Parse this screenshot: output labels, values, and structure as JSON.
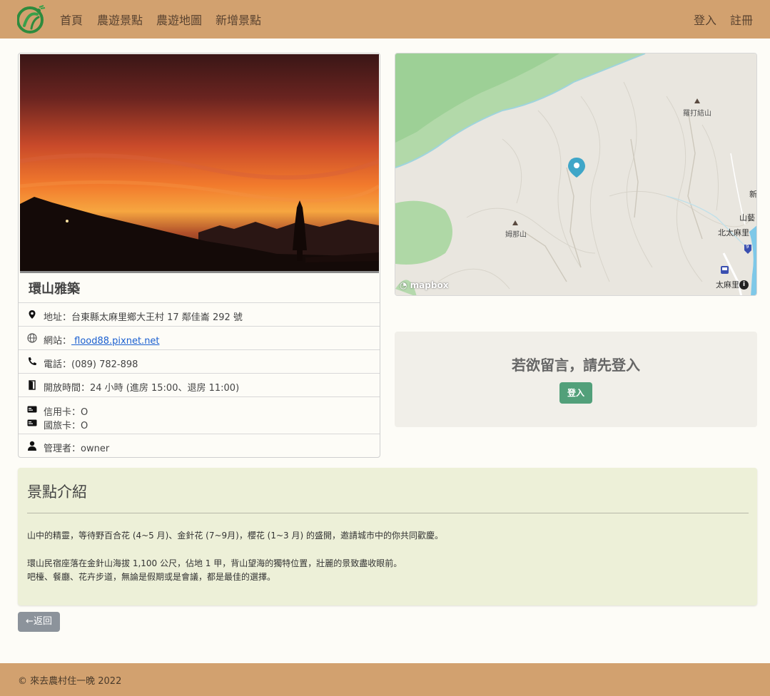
{
  "nav": {
    "home": "首頁",
    "spots": "農遊景點",
    "map": "農遊地圖",
    "add_spot": "新增景點",
    "login": "登入",
    "register": "註冊"
  },
  "spot": {
    "name": "環山雅築",
    "address": "地址：台東縣太麻里鄉大王村 17 鄰佳崙 292 號",
    "website_label": "網站：",
    "website_link": " flood88.pixnet.net",
    "phone": "電話：(089) 782-898",
    "hours": "開放時間：24 小時 (進房 15:00、退房 11:00)",
    "credit_card": "信用卡：O",
    "travel_card": "國旅卡：O",
    "manager": "管理者：owner"
  },
  "map": {
    "labels": {
      "peak1": "羅打結山",
      "peak2": "姆那山",
      "town1": "新",
      "town2": "山藝",
      "town3": "北太麻里",
      "town4": "太麻里",
      "route": "9"
    },
    "attribution": "mapbox",
    "info_glyph": "i"
  },
  "comment": {
    "message": "若欲留言，請先登入",
    "login_button": "登入"
  },
  "intro": {
    "title": "景點介紹",
    "p1": "山中的精靈，等待野百合花 (4~5 月)、金針花 (7~9月)，櫻花 (1~3 月) 的盛開，邀請城市中的你共同歡慶。",
    "p2": "環山民宿座落在金針山海拔 1,100 公尺，佔地 1 甲，背山望海的獨特位置，壯麗的景致盡收眼前。",
    "p3": "吧檯、餐廳、花卉步道，無論是假期或是會議，都是最佳的選擇。"
  },
  "back_button": "←返回",
  "footer": "© 來去農村住一晚 2022",
  "colors": {
    "header": "#d2a16f",
    "page_bg": "#fdfcf7",
    "intro_bg": "#edf0d8",
    "login_button": "#52a07a",
    "back_button": "#8c939b",
    "map_marker": "#3fa6c8"
  }
}
